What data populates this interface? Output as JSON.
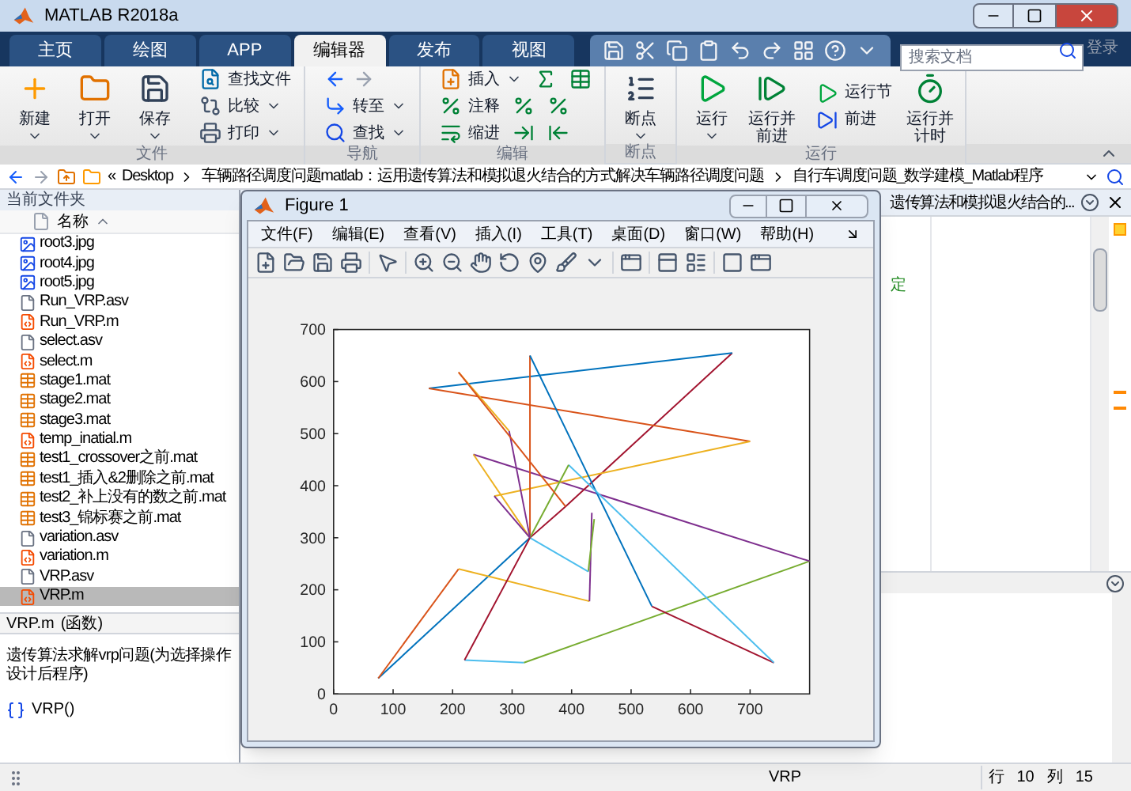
{
  "window": {
    "title": "MATLAB R2018a"
  },
  "tabs": [
    {
      "label": "主页",
      "selected": false
    },
    {
      "label": "绘图",
      "selected": false
    },
    {
      "label": "APP",
      "selected": false
    },
    {
      "label": "编辑器",
      "selected": true
    },
    {
      "label": "发布",
      "selected": false
    },
    {
      "label": "视图",
      "selected": false
    }
  ],
  "search": {
    "placeholder": "搜索文档"
  },
  "login": {
    "label": "登录",
    "disabled": true
  },
  "ribbon": [
    {
      "label": "文件",
      "kind": "file",
      "items": [
        {
          "label": "新建",
          "kind": "large",
          "dropdown": true
        },
        {
          "label": "打开",
          "kind": "large",
          "dropdown": true
        },
        {
          "label": "保存",
          "kind": "large",
          "dropdown": true
        },
        {
          "label": "查找文件",
          "kind": "small",
          "dropdown": false
        },
        {
          "label": "比较",
          "kind": "small",
          "dropdown": true
        },
        {
          "label": "打印",
          "kind": "small",
          "dropdown": true
        }
      ]
    },
    {
      "label": "导航",
      "kind": "nav",
      "items": [
        {
          "label": "转至",
          "kind": "small",
          "dropdown": true
        },
        {
          "label": "查找",
          "kind": "small",
          "dropdown": true
        }
      ]
    },
    {
      "label": "编辑",
      "kind": "edit",
      "items": [
        {
          "label": "插入",
          "kind": "small",
          "dropdown": true
        },
        {
          "label": "注释",
          "kind": "small",
          "dropdown": false
        },
        {
          "label": "缩进",
          "kind": "small",
          "dropdown": false
        }
      ]
    },
    {
      "label": "断点",
      "kind": "breakpoint",
      "items": [
        {
          "label": "断点",
          "kind": "large",
          "dropdown": true
        }
      ]
    },
    {
      "label": "运行",
      "kind": "run",
      "items": [
        {
          "label": "运行",
          "kind": "large",
          "dropdown": true
        },
        {
          "label": "运行并前进",
          "kind": "large",
          "dropdown": false
        },
        {
          "label": "运行节",
          "kind": "small",
          "dropdown": false
        },
        {
          "label": "前进",
          "kind": "small",
          "dropdown": false
        },
        {
          "label": "运行并计时",
          "kind": "large",
          "dropdown": false
        }
      ]
    }
  ],
  "address": {
    "overflow": "«",
    "segments": [
      "Desktop",
      "车辆路径调度问题matlab：运用遗传算法和模拟退火结合的方式解决车辆路径调度问题",
      "自行车调度问题_数学建模_Matlab程序"
    ]
  },
  "files": {
    "title": "当前文件夹",
    "column": "名称",
    "items": [
      {
        "name": "root3.jpg",
        "kind": "image",
        "selected": false
      },
      {
        "name": "root4.jpg",
        "kind": "image",
        "selected": false
      },
      {
        "name": "root5.jpg",
        "kind": "image",
        "selected": false
      },
      {
        "name": "Run_VRP.asv",
        "kind": "text",
        "selected": false
      },
      {
        "name": "Run_VRP.m",
        "kind": "script",
        "selected": false
      },
      {
        "name": "select.asv",
        "kind": "text",
        "selected": false
      },
      {
        "name": "select.m",
        "kind": "script",
        "selected": false
      },
      {
        "name": "stage1.mat",
        "kind": "data",
        "selected": false
      },
      {
        "name": "stage2.mat",
        "kind": "data",
        "selected": false
      },
      {
        "name": "stage3.mat",
        "kind": "data",
        "selected": false
      },
      {
        "name": "temp_inatial.m",
        "kind": "script",
        "selected": false
      },
      {
        "name": "test1_crossover之前.mat",
        "kind": "data",
        "selected": false
      },
      {
        "name": "test1_插入&2删除之前.mat",
        "kind": "data",
        "selected": false
      },
      {
        "name": "test2_补上没有的数之前.mat",
        "kind": "data",
        "selected": false
      },
      {
        "name": "test3_锦标赛之前.mat",
        "kind": "data",
        "selected": false
      },
      {
        "name": "variation.asv",
        "kind": "text",
        "selected": false
      },
      {
        "name": "variation.m",
        "kind": "script",
        "selected": false
      },
      {
        "name": "VRP.asv",
        "kind": "text",
        "selected": false
      },
      {
        "name": "VRP.m",
        "kind": "script",
        "selected": true
      }
    ]
  },
  "details": {
    "name": "VRP.m",
    "type": "(函数)",
    "lines": [
      "遗传算法求解vrp问题(为选择操作",
      "设计后程序)"
    ],
    "function": "VRP()"
  },
  "editor": {
    "tab": "遗传算法和模拟退火结合的...",
    "fragment": "定"
  },
  "status_bar": {
    "function": "VRP",
    "line_label": "行",
    "line": "10",
    "col_label": "列",
    "col": "15"
  },
  "figure": {
    "title": "Figure 1",
    "menus": [
      "文件(F)",
      "编辑(E)",
      "查看(V)",
      "插入(I)",
      "工具(T)",
      "桌面(D)",
      "窗口(W)",
      "帮助(H)"
    ],
    "chart_data": {
      "type": "line",
      "xlim": [
        0,
        800
      ],
      "ylim": [
        0,
        700
      ],
      "xticks": [
        0,
        100,
        200,
        300,
        400,
        500,
        600,
        700
      ],
      "yticks": [
        0,
        100,
        200,
        300,
        400,
        500,
        600,
        700
      ],
      "series": [
        {
          "color": "#0072bd",
          "x": [
            330,
            75
          ],
          "values": [
            300,
            30
          ]
        },
        {
          "color": "#d95319",
          "x": [
            75,
            210
          ],
          "values": [
            30,
            240
          ]
        },
        {
          "color": "#edb120",
          "x": [
            210,
            430
          ],
          "values": [
            240,
            178
          ]
        },
        {
          "color": "#7e2f8e",
          "x": [
            430,
            434
          ],
          "values": [
            178,
            348
          ]
        },
        {
          "color": "#77ac30",
          "x": [
            438,
            428
          ],
          "values": [
            336,
            235
          ]
        },
        {
          "color": "#4dbeee",
          "x": [
            428,
            330
          ],
          "values": [
            235,
            300
          ]
        },
        {
          "color": "#4dbeee",
          "x": [
            220,
            320
          ],
          "values": [
            65,
            60
          ]
        },
        {
          "color": "#77ac30",
          "x": [
            320,
            800
          ],
          "values": [
            60,
            255
          ]
        },
        {
          "color": "#7e2f8e",
          "x": [
            800,
            235
          ],
          "values": [
            255,
            460
          ]
        },
        {
          "color": "#edb120",
          "x": [
            235,
            330
          ],
          "values": [
            460,
            300
          ]
        },
        {
          "color": "#a2142f",
          "x": [
            220,
            330,
            390,
            670
          ],
          "values": [
            65,
            300,
            360,
            655
          ]
        },
        {
          "color": "#0072bd",
          "x": [
            670,
            160
          ],
          "values": [
            655,
            587
          ]
        },
        {
          "color": "#d95319",
          "x": [
            160,
            700
          ],
          "values": [
            587,
            485
          ]
        },
        {
          "color": "#edb120",
          "x": [
            700,
            270
          ],
          "values": [
            485,
            380
          ]
        },
        {
          "color": "#7e2f8e",
          "x": [
            270,
            330
          ],
          "values": [
            380,
            300
          ]
        },
        {
          "color": "#d95319",
          "x": [
            330,
            330
          ],
          "values": [
            300,
            650
          ]
        },
        {
          "color": "#0072bd",
          "x": [
            330,
            535
          ],
          "values": [
            650,
            168
          ]
        },
        {
          "color": "#a2142f",
          "x": [
            535,
            740
          ],
          "values": [
            168,
            60
          ]
        },
        {
          "color": "#4dbeee",
          "x": [
            740,
            395
          ],
          "values": [
            60,
            440
          ]
        },
        {
          "color": "#77ac30",
          "x": [
            395,
            330
          ],
          "values": [
            440,
            300
          ]
        },
        {
          "color": "#7e2f8e",
          "x": [
            330,
            295
          ],
          "values": [
            300,
            505
          ]
        },
        {
          "color": "#edb120",
          "x": [
            295,
            210
          ],
          "values": [
            505,
            618
          ]
        },
        {
          "color": "#d95319",
          "x": [
            210,
            390
          ],
          "values": [
            618,
            360
          ]
        }
      ]
    }
  }
}
